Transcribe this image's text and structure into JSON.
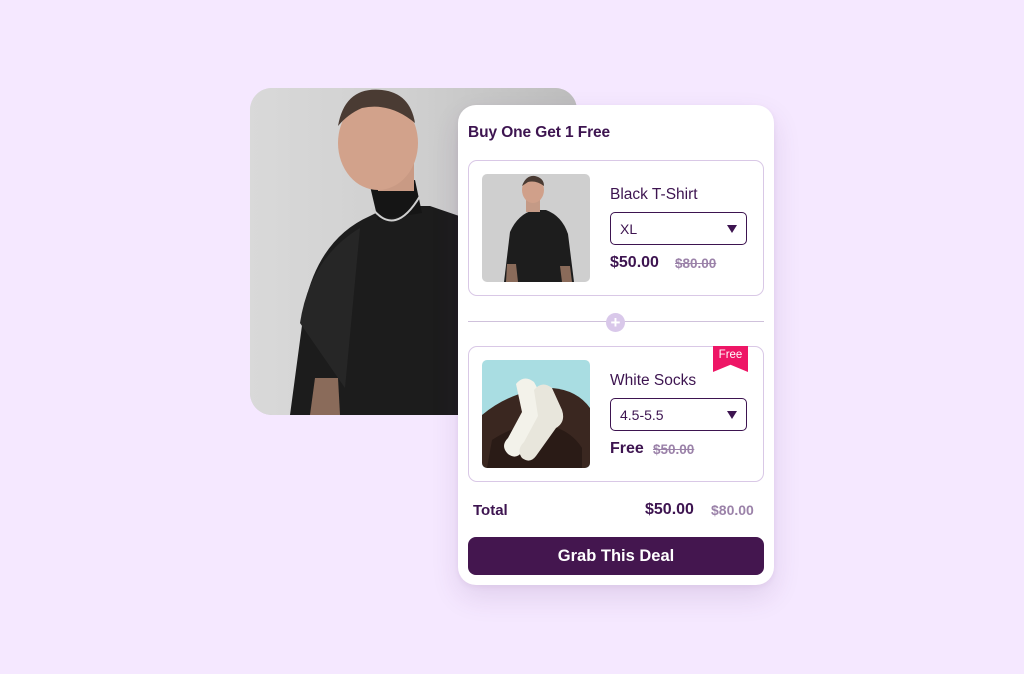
{
  "offer": {
    "title": "Buy One Get 1 Free"
  },
  "products": [
    {
      "name": "Black T-Shirt",
      "size": "XL",
      "price": "$50.00",
      "old_price": "$80.00"
    },
    {
      "name": "White Socks",
      "size": "4.5-5.5",
      "price": "Free",
      "old_price": "$50.00",
      "badge": "Free"
    }
  ],
  "summary": {
    "total_label": "Total",
    "total_value": "$50.00",
    "total_old": "$80.00"
  },
  "cta": {
    "label": "Grab This Deal"
  },
  "colors": {
    "background": "#f5e8ff",
    "primary": "#44164f",
    "badge": "#ee1666",
    "muted": "#9b82a9"
  }
}
